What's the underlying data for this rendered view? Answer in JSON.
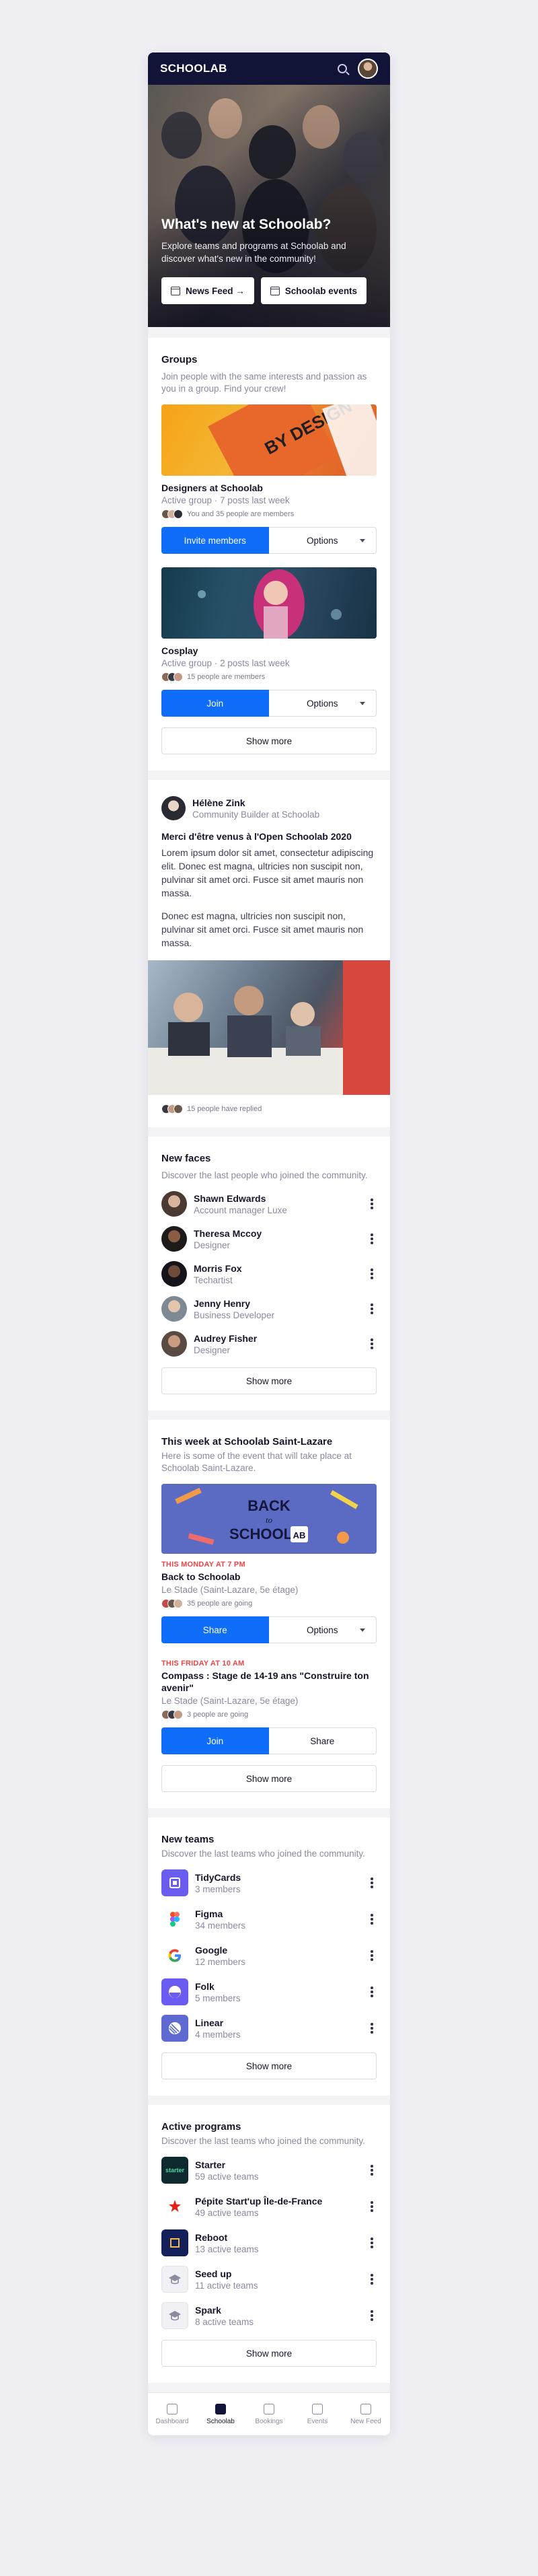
{
  "app": {
    "logo": "SCHOOLAB"
  },
  "hero": {
    "title": "What's new at Schoolab?",
    "subtitle": "Explore teams and programs at Schoolab and discover what's new in the community!",
    "buttons": [
      "News Feed →",
      "Schoolab events"
    ]
  },
  "groups": {
    "title": "Groups",
    "subtitle": "Join people with the same interests and passion as you in a group. Find your crew!",
    "items": [
      {
        "name": "Designers at Schoolab",
        "meta": "Active group · 7 posts last week",
        "members": "You and 35 people are members",
        "primary": "Invite members",
        "secondary": "Options"
      },
      {
        "name": "Cosplay",
        "meta": "Active group · 2 posts last week",
        "members": "15 people are members",
        "primary": "Join",
        "secondary": "Options"
      }
    ],
    "show_more": "Show more"
  },
  "post": {
    "author": "Hélène Zink",
    "role": "Community Builder at Schoolab",
    "title": "Merci d'être venus à l'Open Schoolab 2020",
    "paragraphs": [
      "Lorem ipsum dolor sit amet, consectetur adipiscing elit. Donec est magna, ultricies non suscipit non, pulvinar sit amet orci. Fusce sit amet mauris non massa.",
      "Donec est magna, ultricies non suscipit non, pulvinar sit amet orci. Fusce sit amet mauris non massa."
    ],
    "replies": "15 people have replied"
  },
  "new_faces": {
    "title": "New faces",
    "subtitle": "Discover the last people who joined the community.",
    "people": [
      {
        "name": "Shawn Edwards",
        "role": "Account manager Luxe"
      },
      {
        "name": "Theresa Mccoy",
        "role": "Designer"
      },
      {
        "name": "Morris Fox",
        "role": "Techartist"
      },
      {
        "name": "Jenny Henry",
        "role": "Business Developer"
      },
      {
        "name": "Audrey Fisher",
        "role": "Designer"
      }
    ],
    "show_more": "Show more"
  },
  "events": {
    "title": "This week at Schoolab Saint-Lazare",
    "subtitle": "Here is some of the event that will take place at Schoolab Saint-Lazare.",
    "banner_text": [
      "BACK",
      "to",
      "SCHOOL",
      "AB"
    ],
    "items": [
      {
        "when": "THIS MONDAY AT 7 PM",
        "name": "Back to Schoolab",
        "place": "Le Stade (Saint-Lazare, 5e étage)",
        "going": "35 people are going",
        "primary": "Share",
        "secondary": "Options"
      },
      {
        "when": "THIS FRIDAY AT 10 AM",
        "name": "Compass : Stage de 14-19 ans \"Construire ton avenir\"",
        "place": "Le Stade (Saint-Lazare, 5e étage)",
        "going": "3 people are going",
        "primary": "Join",
        "secondary": "Share"
      }
    ],
    "show_more": "Show more"
  },
  "new_teams": {
    "title": "New teams",
    "subtitle": "Discover the last teams who joined the community.",
    "teams": [
      {
        "name": "TidyCards",
        "meta": "3 members",
        "color": "#6b5cf0"
      },
      {
        "name": "Figma",
        "meta": "34 members",
        "color": "#ffffff"
      },
      {
        "name": "Google",
        "meta": "12 members",
        "color": "#ffffff"
      },
      {
        "name": "Folk",
        "meta": "5 members",
        "color": "#6a5cf0"
      },
      {
        "name": "Linear",
        "meta": "4 members",
        "color": "#5e6ad2"
      }
    ],
    "show_more": "Show more"
  },
  "active_programs": {
    "title": "Active programs",
    "subtitle": "Discover the last teams who joined the community.",
    "programs": [
      {
        "name": "Starter",
        "meta": "59 active teams",
        "logo_text": "starter"
      },
      {
        "name": "Pépite Start'up Île-de-France",
        "meta": "49 active teams",
        "logo_text": ""
      },
      {
        "name": "Reboot",
        "meta": "13 active teams",
        "logo_text": ""
      },
      {
        "name": "Seed up",
        "meta": "11 active teams",
        "logo_text": ""
      },
      {
        "name": "Spark",
        "meta": "8 active teams",
        "logo_text": ""
      }
    ],
    "show_more": "Show more"
  },
  "tabbar": [
    "Dashboard",
    "Schoolab",
    "Bookings",
    "Events",
    "New Feed"
  ],
  "colors": {
    "nav": "#111337",
    "primary": "#0e6ef9",
    "accent_red": "#ef4444"
  }
}
